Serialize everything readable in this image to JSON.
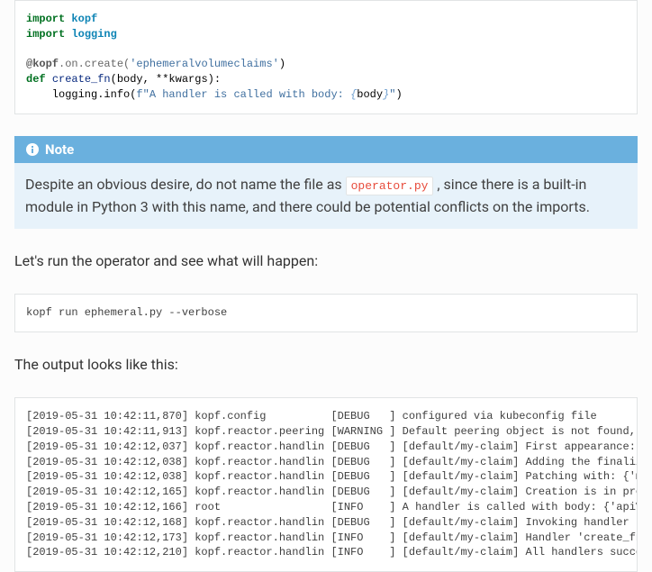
{
  "code1": {
    "l1a": "import",
    "l1b": "kopf",
    "l2a": "import",
    "l2b": "logging",
    "l4a": "@kopf",
    "l4b": ".on.create(",
    "l4c": "'ephemeralvolumeclaims'",
    "l4d": ")",
    "l5a": "def",
    "l5b": "create_fn",
    "l5c": "(body, **kwargs):",
    "l6a": "    logging.info(",
    "l6b": "f\"A handler is called with body: ",
    "l6c": "{",
    "l6d": "body",
    "l6e": "}",
    "l6f": "\"",
    "l6g": ")"
  },
  "note": {
    "title": "Note",
    "pre": "Despite an obvious desire, do not name the file as ",
    "code": "operator.py",
    "post": " , since there is a built-in module in Python 3 with this name, and there could be potential conflicts on the imports."
  },
  "p1": "Let's run the operator and see what will happen:",
  "code2": "kopf run ephemeral.py --verbose",
  "p2": "The output looks like this:",
  "out": {
    "l1": "[2019-05-31 10:42:11,870] kopf.config          [DEBUG   ] configured via kubeconfig file",
    "l2": "[2019-05-31 10:42:11,913] kopf.reactor.peering [WARNING ] Default peering object is not found, falling b",
    "l3": "[2019-05-31 10:42:12,037] kopf.reactor.handlin [DEBUG   ] [default/my-claim] First appearance: {'apiVers",
    "l4": "[2019-05-31 10:42:12,038] kopf.reactor.handlin [DEBUG   ] [default/my-claim] Adding the finalizer, thus ",
    "l5": "[2019-05-31 10:42:12,038] kopf.reactor.handlin [DEBUG   ] [default/my-claim] Patching with: {'metadata' ",
    "l6": "[2019-05-31 10:42:12,165] kopf.reactor.handlin [DEBUG   ] [default/my-claim] Creation is in progress: {'",
    "l7": "[2019-05-31 10:42:12,166] root                 [INFO    ] A handler is called with body: {'apiVersion': ",
    "l8": "[2019-05-31 10:42:12,168] kopf.reactor.handlin [DEBUG   ] [default/my-claim] Invoking handler 'create_fn",
    "l9": "[2019-05-31 10:42:12,173] kopf.reactor.handlin [INFO    ] [default/my-claim] Handler 'create_fn' succeed",
    "l10": "[2019-05-31 10:42:12,210] kopf.reactor.handlin [INFO    ] [default/my-claim] All handlers succeeded for "
  }
}
